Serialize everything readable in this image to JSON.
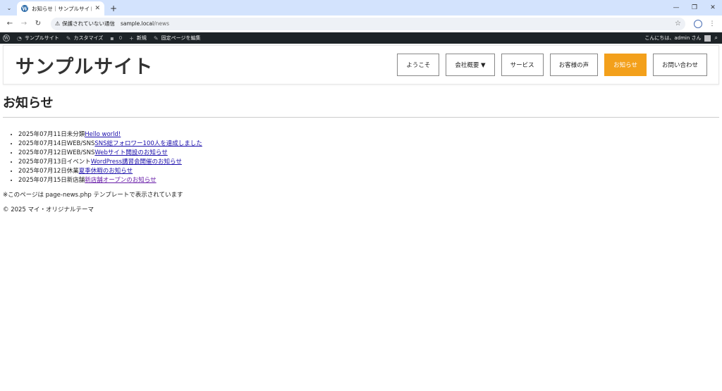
{
  "browser": {
    "tab_title": "お知らせ｜サンプルサイト",
    "favicon": "W",
    "security_label": "保護されていない通信",
    "url_host": "sample.local",
    "url_path": "/news"
  },
  "adminbar": {
    "site_name": "サンプルサイト",
    "customize": "カスタマイズ",
    "comments_count": "0",
    "new": "新規",
    "edit_page": "固定ページを編集",
    "greeting": "こんにちは、admin さん"
  },
  "site": {
    "title": "サンプルサイト",
    "menu": [
      {
        "label": "ようこそ"
      },
      {
        "label": "会社概要 ▼"
      },
      {
        "label": "サービス"
      },
      {
        "label": "お客様の声"
      },
      {
        "label": "お知らせ"
      },
      {
        "label": "お問い合わせ"
      }
    ]
  },
  "page": {
    "title": "お知らせ",
    "news": [
      {
        "date": "2025年07月11日",
        "category": "未分類",
        "link": "Hello world!"
      },
      {
        "date": "2025年07月14日",
        "category": "WEB/SNS",
        "link": "SNS総フォロワー100人を達成しました"
      },
      {
        "date": "2025年07月12日",
        "category": "WEB/SNS",
        "link": "Webサイト開設のお知らせ"
      },
      {
        "date": "2025年07月13日",
        "category": "イベント",
        "link": "WordPress講習会開催のお知らせ"
      },
      {
        "date": "2025年07月12日",
        "category": "休業",
        "link": "夏季休暇のお知らせ"
      },
      {
        "date": "2025年07月15日",
        "category": "新店舗",
        "link": "新店舗オープンのお知らせ"
      }
    ],
    "note": "※このページは page-news.php テンプレートで表示されています",
    "footer": "© 2025 マイ・オリジナルテーマ"
  },
  "colors": {
    "active_menu": "#f3a01b",
    "adminbar": "#1d2327",
    "tabstrip": "#d3e3fd"
  }
}
